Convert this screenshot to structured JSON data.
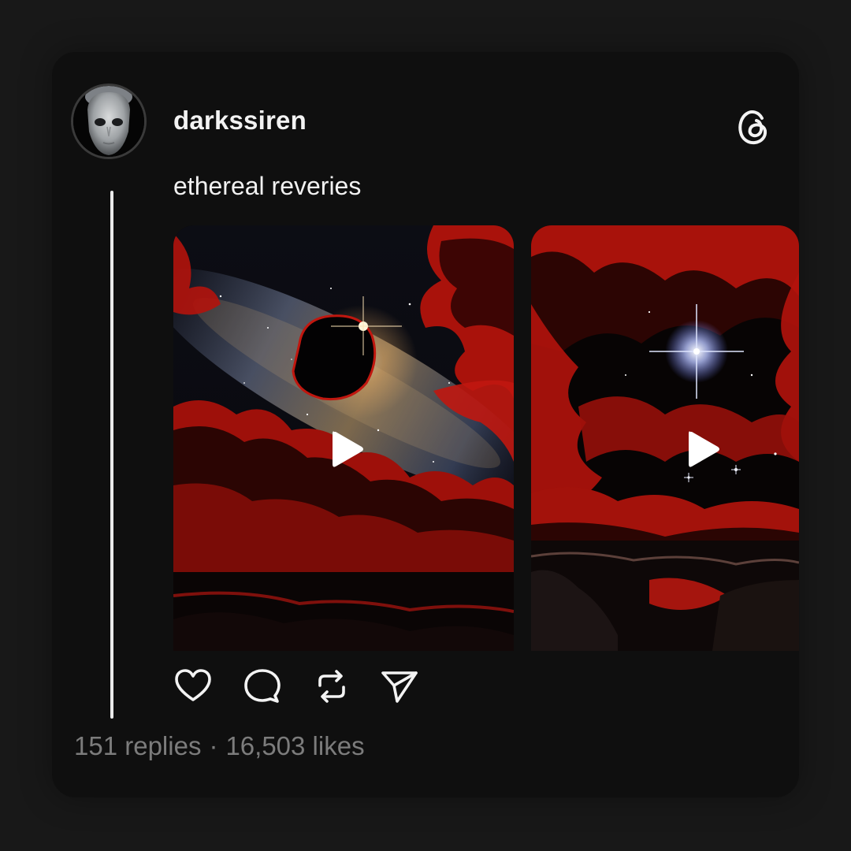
{
  "post": {
    "username": "darkssiren",
    "caption": "ethereal reveries",
    "media": [
      {
        "type": "video",
        "icon": "play-icon"
      },
      {
        "type": "video",
        "icon": "play-icon"
      }
    ],
    "actions": [
      {
        "name": "like",
        "icon": "heart-icon"
      },
      {
        "name": "reply",
        "icon": "comment-icon"
      },
      {
        "name": "repost",
        "icon": "repost-icon"
      },
      {
        "name": "share",
        "icon": "send-icon"
      }
    ],
    "replies_text": "151 replies",
    "separator": "·",
    "likes_text": "16,503 likes"
  },
  "brand": {
    "icon": "threads-logo-icon"
  },
  "colors": {
    "background": "#181818",
    "card": "#0f0f0f",
    "text": "#f3f3f3",
    "muted": "#7c7c7c",
    "accent_red": "#c0170f"
  }
}
